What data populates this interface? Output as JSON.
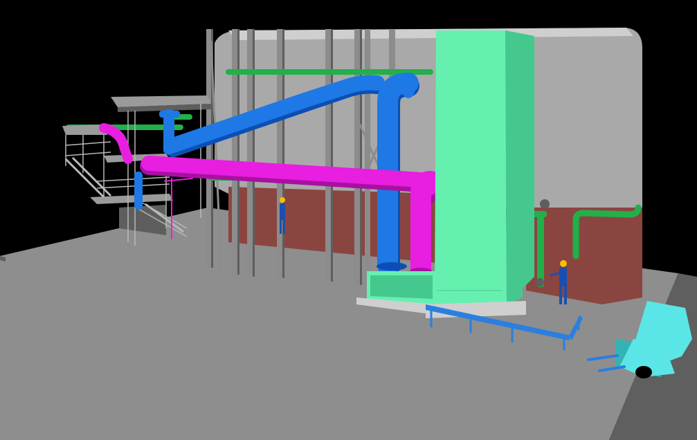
{
  "scene": {
    "colors": {
      "background": "#000000",
      "floor": "#8e8e8e",
      "floor_edge": "#5f5f5f",
      "wall": "#a9a9a9",
      "wall_top": "#cfcfcf",
      "brick": "#8b4540",
      "column": "#8c8c8c",
      "column_shade": "#5e5e5e",
      "tower": "#66f0b0",
      "tower_shade": "#45c88e",
      "blue_pipe": "#1e78e6",
      "blue_pipe_dark": "#0b4fb5",
      "magenta_pipe": "#e81ee0",
      "magenta_pipe_dark": "#a612a0",
      "green_pipe": "#22b04a",
      "green_pipe_dark": "#137a30",
      "railing": "#b8b8b8",
      "platform": "#9a9a9a",
      "guardrail": "#2a7fe0",
      "forklift": "#5ae6e6",
      "forklift_shade": "#33b3b3",
      "worker_body": "#1a4fb0",
      "worker_head": "#f2c200"
    },
    "elements": [
      "floor-slab",
      "back-wall",
      "brick-wall",
      "steel-columns",
      "stair-tower",
      "blue-duct",
      "magenta-duct",
      "green-pipes",
      "cooling-tower",
      "guard-rail",
      "forklift",
      "worker-1",
      "worker-2"
    ]
  }
}
